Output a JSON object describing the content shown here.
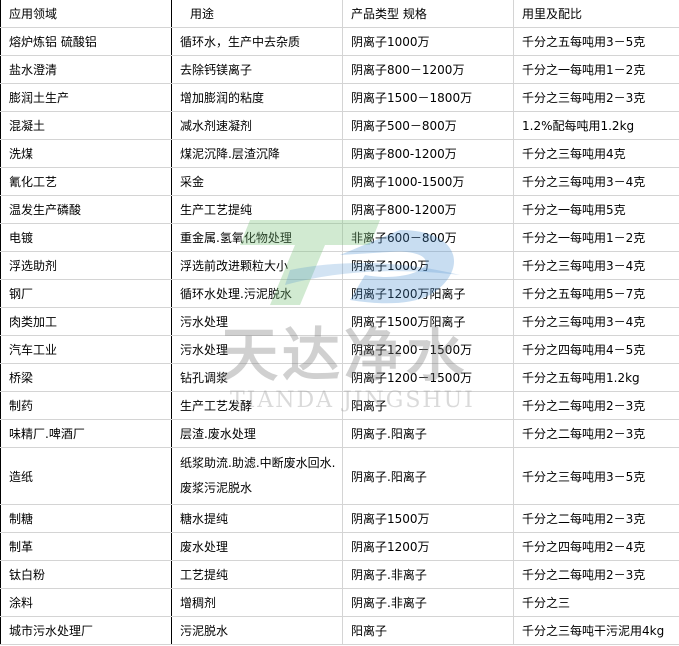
{
  "table": {
    "headers": [
      "应用领域",
      "用途",
      "产品类型 规格",
      "用里及配比"
    ],
    "rows": [
      [
        "熔炉炼铝  硫酸铝",
        "循环水，生产中去杂质",
        "阴离子1000万",
        "千分之五每吨用3－5克"
      ],
      [
        "盐水澄清",
        "去除钙镁离子",
        "阴离子800－1200万",
        "千分之一每吨用1－2克"
      ],
      [
        "膨润土生产",
        "增加膨润的粘度",
        "阴离子1500－1800万",
        "千分之三每吨用2－3克"
      ],
      [
        "混凝土",
        "减水剂速凝剂",
        "阴离子500－800万",
        "1.2%配每吨用1.2kg"
      ],
      [
        "洗煤",
        "煤泥沉降.层渣沉降",
        "阴离子800-1200万",
        "千分之三每吨用4克"
      ],
      [
        "氰化工艺",
        "采金",
        "阴离子1000-1500万",
        "千分之三每吨用3－4克"
      ],
      [
        "温发生产磷酸",
        "生产工艺提纯",
        "阴离子800-1200万",
        "千分之一每吨用5克"
      ],
      [
        "电镀",
        "重金属.氢氧化物处理",
        "非离子600－800万",
        "千分之一每吨用1－2克"
      ],
      [
        "浮选助剂",
        "浮选前改进颗粒大小",
        "阴离子1000万",
        "千分之三每吨用3－4克"
      ],
      [
        "钢厂",
        "循环水处理.污泥脱水",
        "阴离子1200万阳离子",
        "千分之五每吨用5－7克"
      ],
      [
        "肉类加工",
        "污水处理",
        "阴离子1500万阳离子",
        "千分之三每吨用3－4克"
      ],
      [
        "汽车工业",
        "污水处理",
        "阴离子1200－1500万",
        "千分之四每吨用4－5克"
      ],
      [
        "桥梁",
        "钻孔调浆",
        "阴离子1200－1500万",
        "千分之五每吨用1.2kg"
      ],
      [
        "制药",
        "生产工艺发酵",
        "阳离子",
        "千分之二每吨用2－3克"
      ],
      [
        "味精厂.啤酒厂",
        "层渣.废水处理",
        "阴离子.阳离子",
        "千分之二每吨用2－3克"
      ],
      [
        "造纸",
        "纸浆助流.助滤.中断废水回水.废浆污泥脱水",
        "阴离子.阳离子",
        "千分之三每吨用3－5克"
      ],
      [
        "制糖",
        "糖水提纯",
        "阴离子1500万",
        "千分之二每吨用2－3克"
      ],
      [
        "制革",
        "废水处理",
        "阴离子1200万",
        "千分之四每吨用2－4克"
      ],
      [
        "钛白粉",
        "工艺提纯",
        "阴离子.非离子",
        "千分之二每吨用2－3克"
      ],
      [
        "涂料",
        "增稠剂",
        "阴离子.非离子",
        "千分之三"
      ],
      [
        "城市污水处理厂",
        "污泥脱水",
        "阳离子",
        "千分之三每吨干污泥用4kg"
      ]
    ]
  },
  "watermark": {
    "brand_cn": "天达净水",
    "brand_en": "TIANDA  JINGSHUI",
    "logo_icon": "td-logo-icon",
    "colors": {
      "green": "#7cc47a",
      "blue": "#4a8fd0",
      "gray": "#888888"
    }
  }
}
